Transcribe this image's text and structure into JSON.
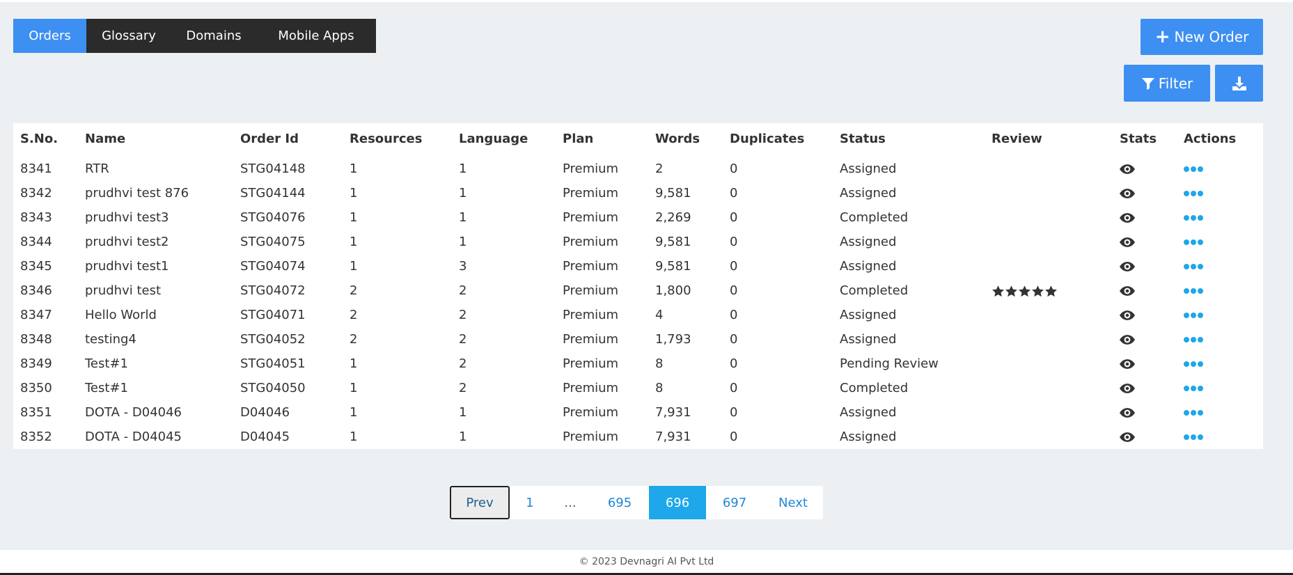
{
  "nav": {
    "tabs": [
      {
        "label": "Orders",
        "active": true
      },
      {
        "label": "Glossary",
        "active": false
      },
      {
        "label": "Domains",
        "active": false
      },
      {
        "label": "Mobile Apps",
        "active": false
      }
    ]
  },
  "toolbar": {
    "new_order_label": "New Order",
    "filter_label": "Filter",
    "download_icon": "download-icon"
  },
  "table": {
    "headers": [
      "S.No.",
      "Name",
      "Order Id",
      "Resources",
      "Language",
      "Plan",
      "Words",
      "Duplicates",
      "Status",
      "Review",
      "Stats",
      "Actions"
    ],
    "rows": [
      {
        "sno": "8341",
        "name": "RTR",
        "order_id": "STG04148",
        "resources": "1",
        "language": "1",
        "plan": "Premium",
        "words": "2",
        "duplicates": "0",
        "status": "Assigned",
        "review_stars": 0
      },
      {
        "sno": "8342",
        "name": "prudhvi test 876",
        "order_id": "STG04144",
        "resources": "1",
        "language": "1",
        "plan": "Premium",
        "words": "9,581",
        "duplicates": "0",
        "status": "Assigned",
        "review_stars": 0
      },
      {
        "sno": "8343",
        "name": "prudhvi test3",
        "order_id": "STG04076",
        "resources": "1",
        "language": "1",
        "plan": "Premium",
        "words": "2,269",
        "duplicates": "0",
        "status": "Completed",
        "review_stars": 0
      },
      {
        "sno": "8344",
        "name": "prudhvi test2",
        "order_id": "STG04075",
        "resources": "1",
        "language": "1",
        "plan": "Premium",
        "words": "9,581",
        "duplicates": "0",
        "status": "Assigned",
        "review_stars": 0
      },
      {
        "sno": "8345",
        "name": "prudhvi test1",
        "order_id": "STG04074",
        "resources": "1",
        "language": "3",
        "plan": "Premium",
        "words": "9,581",
        "duplicates": "0",
        "status": "Assigned",
        "review_stars": 0
      },
      {
        "sno": "8346",
        "name": "prudhvi test",
        "order_id": "STG04072",
        "resources": "2",
        "language": "2",
        "plan": "Premium",
        "words": "1,800",
        "duplicates": "0",
        "status": "Completed",
        "review_stars": 5
      },
      {
        "sno": "8347",
        "name": "Hello World",
        "order_id": "STG04071",
        "resources": "2",
        "language": "2",
        "plan": "Premium",
        "words": "4",
        "duplicates": "0",
        "status": "Assigned",
        "review_stars": 0
      },
      {
        "sno": "8348",
        "name": "testing4",
        "order_id": "STG04052",
        "resources": "2",
        "language": "2",
        "plan": "Premium",
        "words": "1,793",
        "duplicates": "0",
        "status": "Assigned",
        "review_stars": 0
      },
      {
        "sno": "8349",
        "name": "Test#1",
        "order_id": "STG04051",
        "resources": "1",
        "language": "2",
        "plan": "Premium",
        "words": "8",
        "duplicates": "0",
        "status": "Pending Review",
        "review_stars": 0
      },
      {
        "sno": "8350",
        "name": "Test#1",
        "order_id": "STG04050",
        "resources": "1",
        "language": "2",
        "plan": "Premium",
        "words": "8",
        "duplicates": "0",
        "status": "Completed",
        "review_stars": 0
      },
      {
        "sno": "8351",
        "name": "DOTA - D04046",
        "order_id": "D04046",
        "resources": "1",
        "language": "1",
        "plan": "Premium",
        "words": "7,931",
        "duplicates": "0",
        "status": "Assigned",
        "review_stars": 0
      },
      {
        "sno": "8352",
        "name": "DOTA - D04045",
        "order_id": "D04045",
        "resources": "1",
        "language": "1",
        "plan": "Premium",
        "words": "7,931",
        "duplicates": "0",
        "status": "Assigned",
        "review_stars": 0
      }
    ]
  },
  "pagination": {
    "prev": "Prev",
    "first": "1",
    "ellipsis": "...",
    "pages": [
      "695",
      "696",
      "697"
    ],
    "current": "696",
    "next": "Next"
  },
  "footer": {
    "text": "© 2023 Devnagri AI Pvt Ltd"
  },
  "colors": {
    "accent": "#3d8ff2",
    "page_active": "#1ea7ea",
    "nav_bg": "#2b2b2b",
    "page_bg": "#edf0f3"
  }
}
